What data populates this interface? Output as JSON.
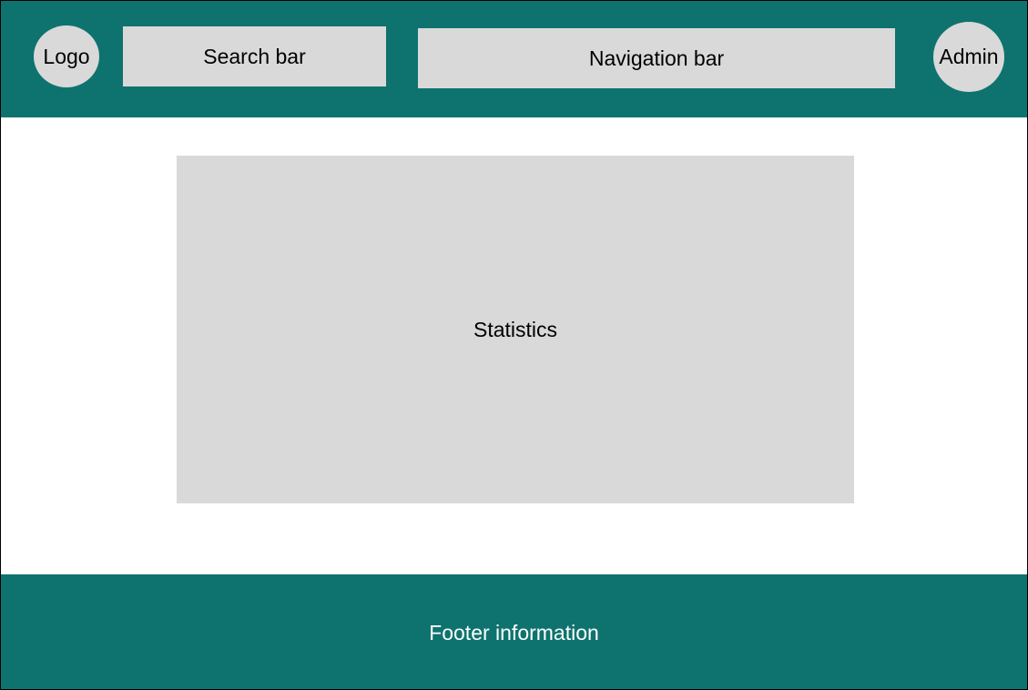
{
  "colors": {
    "header_bg": "#0e736f",
    "footer_bg": "#0e736f",
    "placeholder_bg": "#d9d9d9",
    "page_bg": "#ffffff"
  },
  "header": {
    "logo_label": "Logo",
    "search_label": "Search bar",
    "nav_label": "Navigation bar",
    "admin_label": "Admin"
  },
  "main": {
    "statistics_label": "Statistics"
  },
  "footer": {
    "text": "Footer information"
  }
}
